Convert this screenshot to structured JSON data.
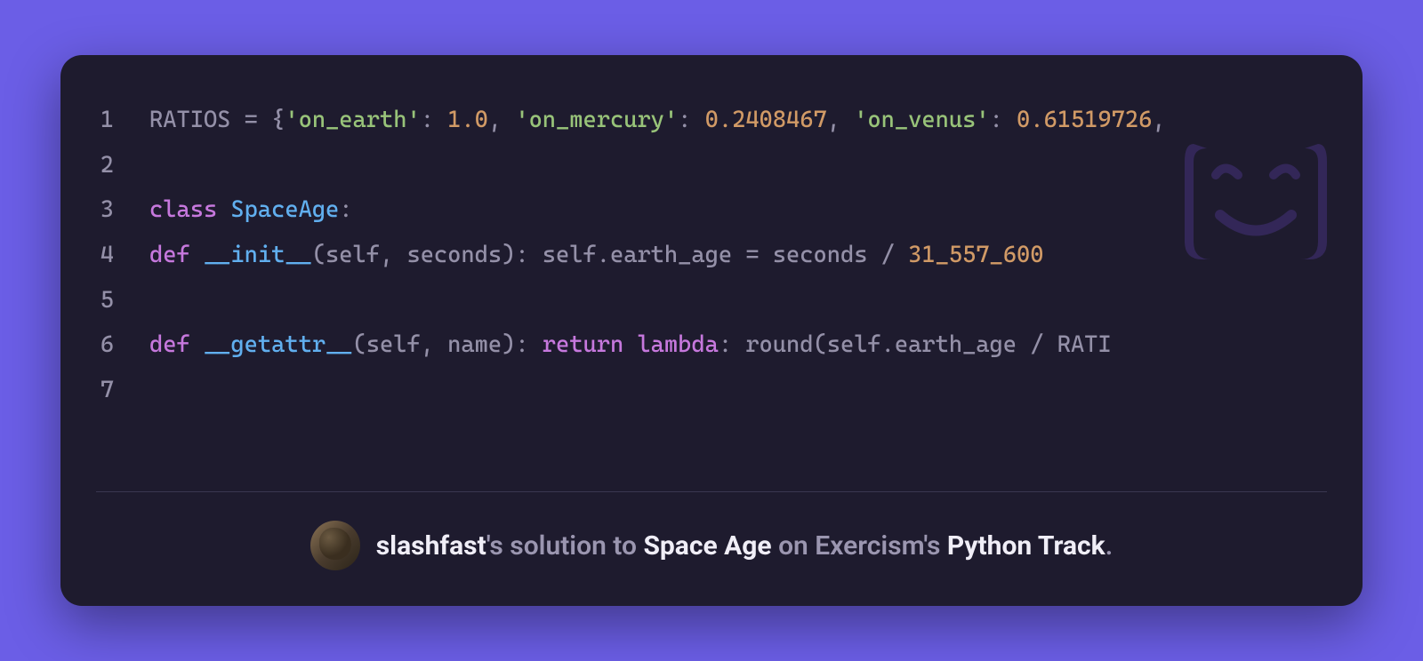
{
  "code": {
    "lines": [
      {
        "num": "1",
        "tokens": [
          {
            "t": "RATIOS ",
            "c": "tok-var"
          },
          {
            "t": "=",
            "c": "tok-op"
          },
          {
            "t": " {",
            "c": "tok-punct"
          },
          {
            "t": "'on_earth'",
            "c": "tok-string"
          },
          {
            "t": ": ",
            "c": "tok-punct"
          },
          {
            "t": "1.0",
            "c": "tok-number"
          },
          {
            "t": ", ",
            "c": "tok-punct"
          },
          {
            "t": "'on_mercury'",
            "c": "tok-string"
          },
          {
            "t": ": ",
            "c": "tok-punct"
          },
          {
            "t": "0.2408467",
            "c": "tok-number"
          },
          {
            "t": ", ",
            "c": "tok-punct"
          },
          {
            "t": "'on_venus'",
            "c": "tok-string"
          },
          {
            "t": ": ",
            "c": "tok-punct"
          },
          {
            "t": "0.61519726",
            "c": "tok-number"
          },
          {
            "t": ",",
            "c": "tok-punct"
          }
        ]
      },
      {
        "num": "2",
        "tokens": []
      },
      {
        "num": "3",
        "tokens": [
          {
            "t": "class",
            "c": "tok-keyword"
          },
          {
            "t": " ",
            "c": ""
          },
          {
            "t": "SpaceAge",
            "c": "tok-classname"
          },
          {
            "t": ":",
            "c": "tok-punct"
          }
        ]
      },
      {
        "num": "4",
        "tokens": [
          {
            "t": "    ",
            "c": ""
          },
          {
            "t": "def",
            "c": "tok-keyword"
          },
          {
            "t": " ",
            "c": ""
          },
          {
            "t": "__init__",
            "c": "tok-funcname"
          },
          {
            "t": "(",
            "c": "tok-punct"
          },
          {
            "t": "self",
            "c": "tok-self"
          },
          {
            "t": ", seconds): ",
            "c": "tok-punct"
          },
          {
            "t": "self",
            "c": "tok-self"
          },
          {
            "t": ".earth_age ",
            "c": "tok-var"
          },
          {
            "t": "=",
            "c": "tok-op"
          },
          {
            "t": " seconds ",
            "c": "tok-var"
          },
          {
            "t": "/",
            "c": "tok-op"
          },
          {
            "t": " ",
            "c": ""
          },
          {
            "t": "31_557_600",
            "c": "tok-number"
          }
        ]
      },
      {
        "num": "5",
        "tokens": []
      },
      {
        "num": "6",
        "tokens": [
          {
            "t": "    ",
            "c": ""
          },
          {
            "t": "def",
            "c": "tok-keyword"
          },
          {
            "t": " ",
            "c": ""
          },
          {
            "t": "__getattr__",
            "c": "tok-funcname"
          },
          {
            "t": "(",
            "c": "tok-punct"
          },
          {
            "t": "self",
            "c": "tok-self"
          },
          {
            "t": ", name): ",
            "c": "tok-punct"
          },
          {
            "t": "return",
            "c": "tok-keyword"
          },
          {
            "t": " ",
            "c": ""
          },
          {
            "t": "lambda",
            "c": "tok-keyword"
          },
          {
            "t": ": ",
            "c": "tok-punct"
          },
          {
            "t": "round",
            "c": "tok-builtin"
          },
          {
            "t": "(",
            "c": "tok-punct"
          },
          {
            "t": "self",
            "c": "tok-self"
          },
          {
            "t": ".earth_age ",
            "c": "tok-var"
          },
          {
            "t": "/",
            "c": "tok-op"
          },
          {
            "t": " RATI",
            "c": "tok-var"
          }
        ]
      },
      {
        "num": "7",
        "tokens": []
      }
    ]
  },
  "footer": {
    "username": "slashfast",
    "possessive1": "'s ",
    "solution_to": "solution to ",
    "exercise": "Space Age",
    "on": " on ",
    "platform": "Exercism",
    "possessive2": "'s ",
    "track": "Python Track",
    "period": "."
  }
}
